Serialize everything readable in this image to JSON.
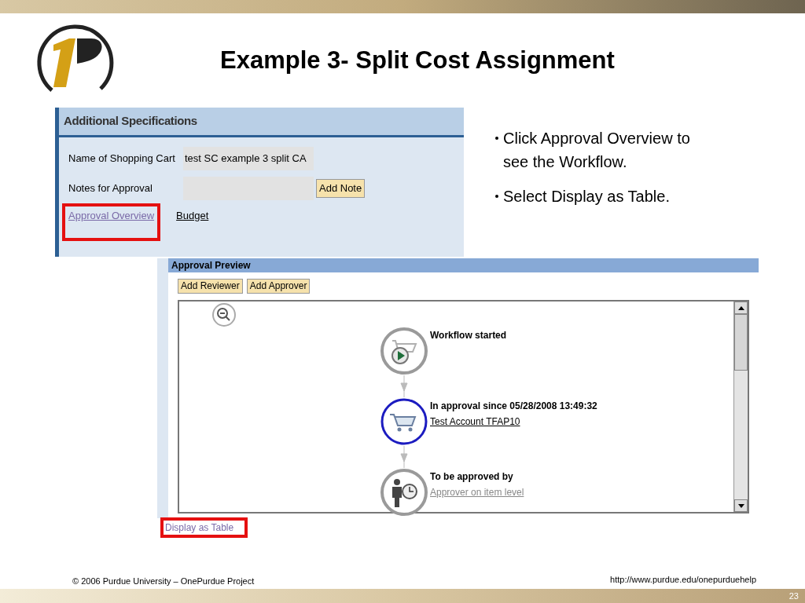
{
  "slide": {
    "title": "Example 3- Split Cost Assignment",
    "number": "23"
  },
  "spec_panel": {
    "title": "Additional Specifications",
    "fields": [
      {
        "label": "Name of Shopping Cart",
        "value": "test SC example 3 split CA"
      },
      {
        "label": "Notes for Approval",
        "button": "Add Note"
      }
    ],
    "links": [
      {
        "label": "Approval Overview",
        "visited": true,
        "highlighted": true
      },
      {
        "label": "Budget",
        "visited": false,
        "highlighted": false
      }
    ]
  },
  "bullets": [
    "Click Approval Overview to see the Workflow.",
    "Select Display as Table."
  ],
  "approval_preview": {
    "title": "Approval Preview",
    "buttons": [
      "Add Reviewer",
      "Add Approver"
    ],
    "steps": [
      {
        "kind": "start",
        "title": "Workflow started"
      },
      {
        "kind": "current",
        "title": "In approval since 05/28/2008 13:49:32",
        "link": "Test Account TFAP10"
      },
      {
        "kind": "pending",
        "title": "To be approved by",
        "link": "Approver on item level"
      }
    ],
    "bottom_link": {
      "label": "Display as Table",
      "highlighted": true
    }
  },
  "footer": {
    "copyright": "© 2006 Purdue University – OnePurdue Project",
    "url": "http://www.purdue.edu/onepurduehelp"
  }
}
